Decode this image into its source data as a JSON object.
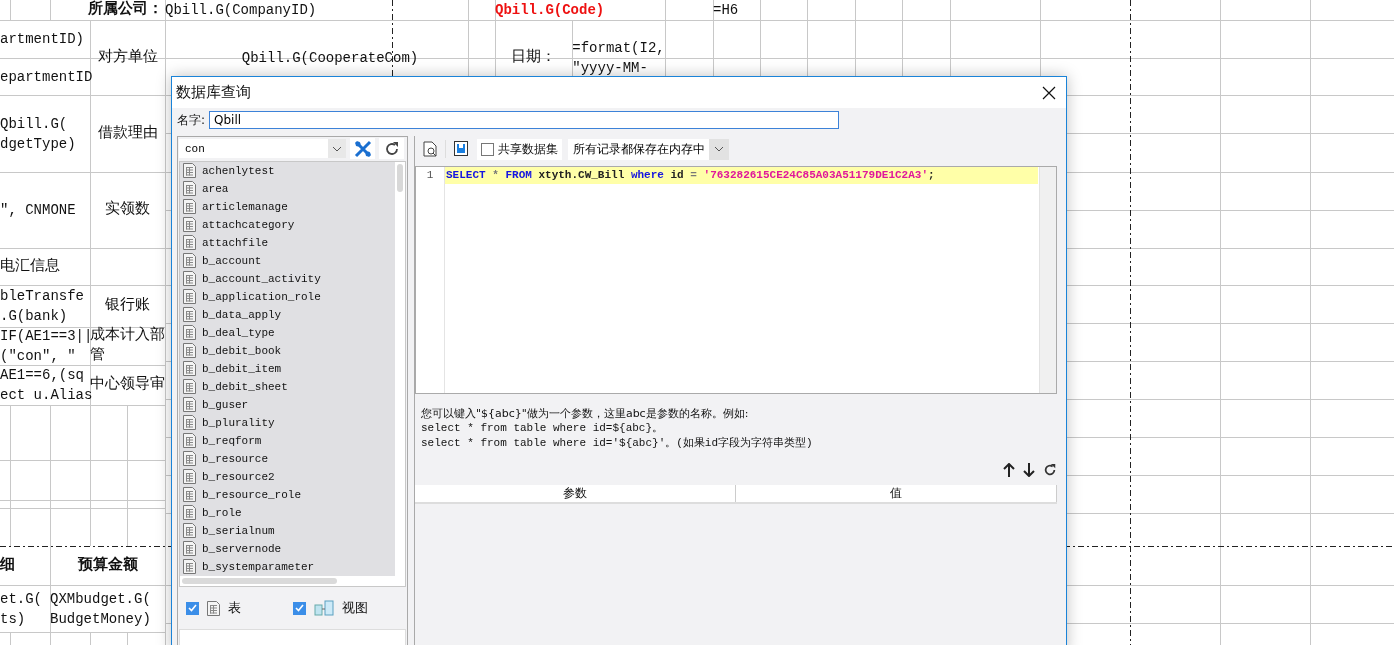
{
  "sheet": {
    "cells": [
      {
        "lines": [
          "所属公司："
        ],
        "kind": "heading"
      },
      {
        "lines": [
          "Qbill.G(CompanyID)"
        ],
        "kind": "text"
      },
      {
        "lines": [
          "Qbill.G(Code)"
        ],
        "kind": "expression"
      },
      {
        "lines": [
          "=H6"
        ],
        "kind": "text"
      },
      {
        "lines": [
          "artmentID)"
        ],
        "kind": "text"
      },
      {
        "lines": [
          "epartmentID"
        ],
        "kind": "text"
      },
      {
        "lines": [
          "对方单位"
        ],
        "kind": "label"
      },
      {
        "lines": [
          "Qbill.G(CooperateCom)"
        ],
        "kind": "text"
      },
      {
        "lines": [
          "日期："
        ],
        "kind": "label"
      },
      {
        "lines": [
          "=format(I2,",
          "\"yyyy-MM-"
        ],
        "kind": "text"
      },
      {
        "lines": [
          "Qbill.G(",
          "dgetType)"
        ],
        "kind": "text"
      },
      {
        "lines": [
          "借款理由"
        ],
        "kind": "label"
      },
      {
        "lines": [
          "\", CNMONE"
        ],
        "kind": "text"
      },
      {
        "lines": [
          "实领数"
        ],
        "kind": "label"
      },
      {
        "lines": [
          "电汇信息"
        ],
        "kind": "label"
      },
      {
        "lines": [
          "bleTransfe",
          ".G(bank)"
        ],
        "kind": "text"
      },
      {
        "lines": [
          "银行账"
        ],
        "kind": "label"
      },
      {
        "lines": [
          "IF(AE1==3||",
          "(\"con\", \""
        ],
        "kind": "text"
      },
      {
        "lines": [
          "成本计入部",
          "管"
        ],
        "kind": "label"
      },
      {
        "lines": [
          "AE1==6,(sq",
          "ect u.Alias"
        ],
        "kind": "text"
      },
      {
        "lines": [
          "中心领导审"
        ],
        "kind": "label"
      },
      {
        "lines": [
          "细"
        ],
        "kind": "heading"
      },
      {
        "lines": [
          "预算金额"
        ],
        "kind": "heading"
      },
      {
        "lines": [
          "et.G(",
          "ts)"
        ],
        "kind": "text"
      },
      {
        "lines": [
          "QXMbudget.G(",
          "BudgetMoney)"
        ],
        "kind": "text"
      }
    ]
  },
  "dialog": {
    "title": "数据库查询",
    "name_label": "名字:",
    "name_value": "Qbill",
    "connection": "con",
    "tables": [
      "achenlytest",
      "area",
      "articlemanage",
      "attachcategory",
      "attachfile",
      "b_account",
      "b_account_activity",
      "b_application_role",
      "b_data_apply",
      "b_deal_type",
      "b_debit_book",
      "b_debit_item",
      "b_debit_sheet",
      "b_guser",
      "b_plurality",
      "b_reqform",
      "b_resource",
      "b_resource2",
      "b_resource_role",
      "b_role",
      "b_serialnum",
      "b_servernode",
      "b_systemparameter"
    ],
    "filters": [
      {
        "label": "表",
        "checked": true,
        "kind": "table"
      },
      {
        "label": "视图",
        "checked": true,
        "kind": "view"
      }
    ],
    "share": {
      "label": "共享数据集",
      "checked": false
    },
    "storage_mode": "所有记录都保存在内存中",
    "editor": {
      "lines": [
        {
          "number": "1",
          "tokens": [
            {
              "text": "SELECT",
              "kind": "keyword"
            },
            {
              "text": "*",
              "kind": "operator"
            },
            {
              "text": "FROM",
              "kind": "keyword"
            },
            {
              "text": "xtyth.CW_Bill",
              "kind": "plain"
            },
            {
              "text": "where",
              "kind": "keyword"
            },
            {
              "text": "id",
              "kind": "plain"
            },
            {
              "text": "=",
              "kind": "operator"
            },
            {
              "text": "'763282615CE24C85A03A51179DE1C2A3'",
              "kind": "string"
            },
            {
              "text": ";",
              "kind": "plain"
            }
          ]
        }
      ]
    },
    "hint": [
      "您可以键入\"${abc}\"做为一个参数，这里abc是参数的名称。例如:",
      "select * from table where id=${abc}。",
      "select * from table where id='${abc}'。(如果id字段为字符串类型)"
    ],
    "param_table": {
      "columns": [
        "参数",
        "值"
      ]
    }
  }
}
